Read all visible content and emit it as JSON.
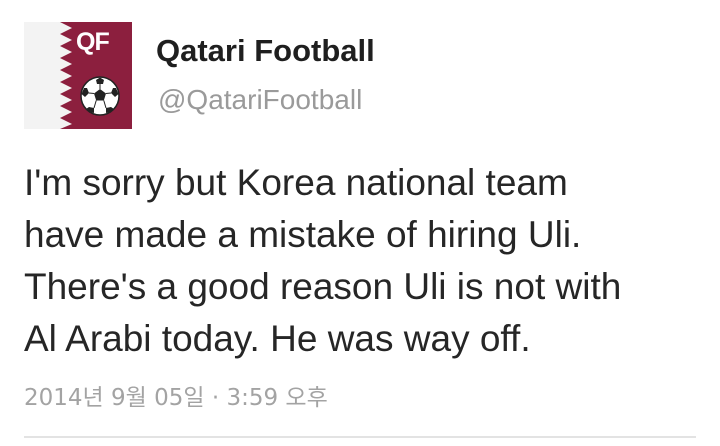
{
  "tweet": {
    "avatar": {
      "logo_text": "QF",
      "colors": {
        "maroon": "#8c1f3e",
        "white": "#ffffff"
      },
      "icon": "soccer-ball-icon"
    },
    "display_name": "Qatari Football",
    "handle": "@QatariFootball",
    "text_lines": [
      "I'm sorry but Korea national team",
      "have made a mistake of hiring Uli.",
      "There's a good reason Uli is not with",
      "Al Arabi today. He was way off."
    ],
    "timestamp": "2014년 9월 05일 · 3:59 오후"
  }
}
